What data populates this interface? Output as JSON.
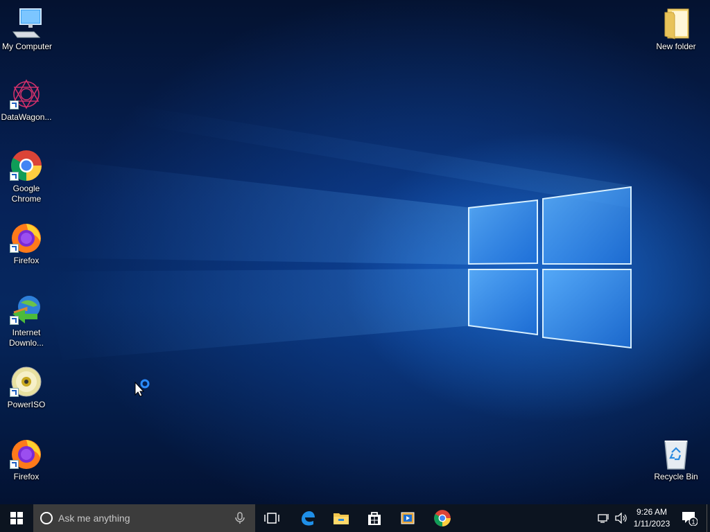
{
  "desktop": {
    "icons": [
      {
        "label": "My Computer",
        "icon": "computer-icon"
      },
      {
        "label": "DataWagon...",
        "icon": "datawagon-icon",
        "shortcut": true
      },
      {
        "label": "Google\nChrome",
        "icon": "chrome-icon",
        "shortcut": true
      },
      {
        "label": "Firefox",
        "icon": "firefox-icon",
        "shortcut": true
      },
      {
        "label": "Internet\nDownlo...",
        "icon": "internet-download-manager-icon",
        "shortcut": true
      },
      {
        "label": "PowerISO",
        "icon": "poweriso-icon",
        "shortcut": true
      },
      {
        "label": "Firefox",
        "icon": "firefox-icon",
        "shortcut": true
      },
      {
        "label": "New folder",
        "icon": "folder-icon"
      },
      {
        "label": "Recycle Bin",
        "icon": "recycle-bin-icon"
      }
    ]
  },
  "taskbar": {
    "search_placeholder": "Ask me anything",
    "pinned": [
      "task-view-icon",
      "edge-icon",
      "file-explorer-icon",
      "store-icon",
      "media-player-icon",
      "chrome-icon"
    ],
    "clock": {
      "time": "9:26 AM",
      "date": "1/11/2023"
    },
    "notification_count": "1"
  },
  "colors": {
    "taskbar": "#0c1420",
    "search_box": "#3c3c3c",
    "accent": "#0078d7"
  }
}
